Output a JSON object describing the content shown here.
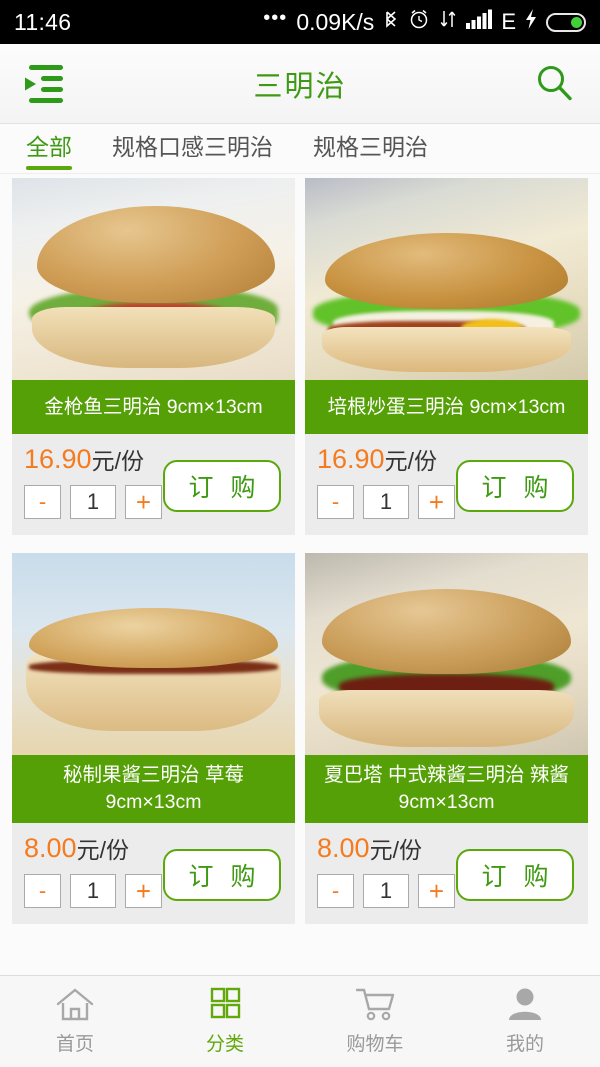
{
  "statusbar": {
    "time": "11:46",
    "dots": "•••",
    "network_speed": "0.09K/s",
    "network_type": "E",
    "icons": [
      "bluetooth-icon",
      "alarm-icon",
      "data-transfer-icon",
      "signal-bars-icon",
      "charging-bolt-icon",
      "battery-icon"
    ]
  },
  "header": {
    "title": "三明治",
    "menu_icon": "menu-collapse-icon",
    "search_icon": "search-icon",
    "accent_color": "#3e9a12"
  },
  "tabs": [
    {
      "label": "全部",
      "active": true
    },
    {
      "label": "规格口感三明治",
      "active": false
    },
    {
      "label": "规格三明治",
      "active": false
    }
  ],
  "products": [
    {
      "title": "金枪鱼三明治 9cm×13cm",
      "price": "16.90",
      "unit": "元/份",
      "quantity": "1",
      "minus": "-",
      "plus": "+",
      "order_label": "订 购",
      "photo": "tuna-sandwich-photo"
    },
    {
      "title": "培根炒蛋三明治 9cm×13cm",
      "price": "16.90",
      "unit": "元/份",
      "quantity": "1",
      "minus": "-",
      "plus": "+",
      "order_label": "订 购",
      "photo": "bacon-egg-sandwich-photo"
    },
    {
      "title": "秘制果酱三明治 草莓 9cm×13cm",
      "price": "8.00",
      "unit": "元/份",
      "quantity": "1",
      "minus": "-",
      "plus": "+",
      "order_label": "订 购",
      "photo": "jam-sandwich-photo"
    },
    {
      "title": "夏巴塔 中式辣酱三明治 辣酱 9cm×13cm",
      "price": "8.00",
      "unit": "元/份",
      "quantity": "1",
      "minus": "-",
      "plus": "+",
      "order_label": "订 购",
      "photo": "chili-sauce-sandwich-photo"
    }
  ],
  "bottomnav": [
    {
      "label": "首页",
      "icon": "home-icon",
      "active": false
    },
    {
      "label": "分类",
      "icon": "grid-icon",
      "active": true
    },
    {
      "label": "购物车",
      "icon": "cart-icon",
      "active": false
    },
    {
      "label": "我的",
      "icon": "person-icon",
      "active": false
    }
  ],
  "colors": {
    "brand_green": "#54a006",
    "title_green": "#3e9a12",
    "price_orange": "#f47b20",
    "card_bg": "#ececec",
    "page_bg": "#fbfbfb"
  }
}
